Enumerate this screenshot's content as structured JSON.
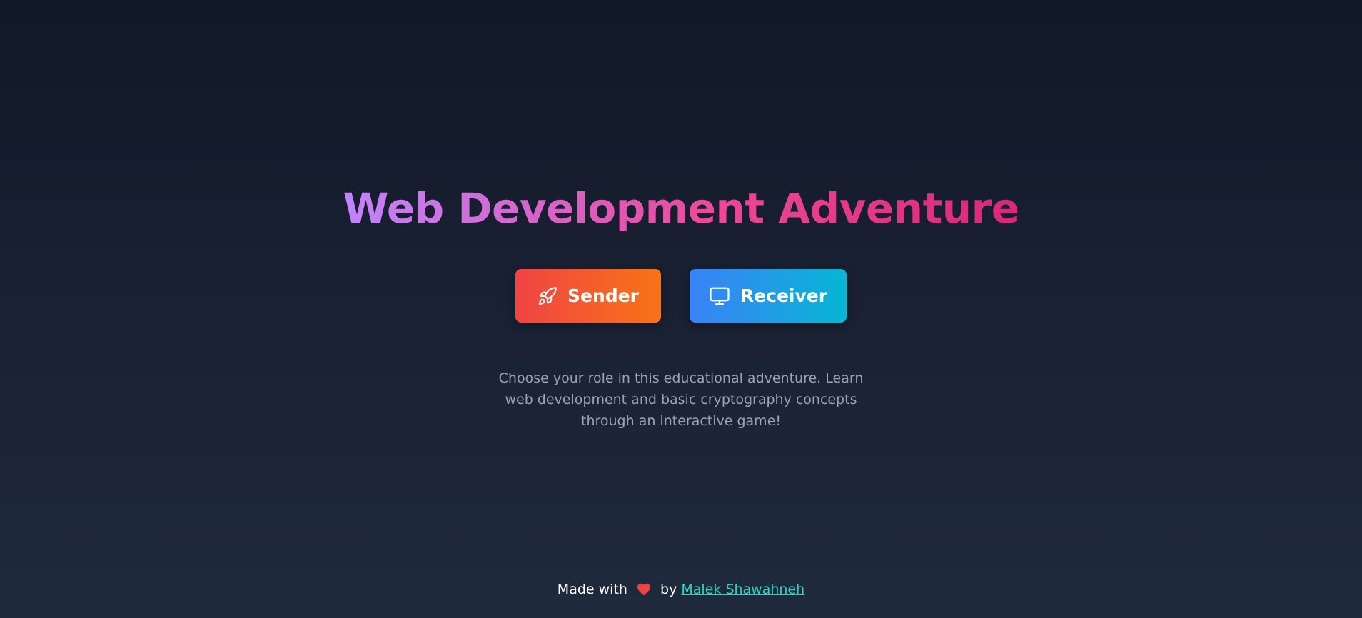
{
  "title": "Web Development Adventure",
  "buttons": {
    "sender": {
      "label": "Sender",
      "icon": "rocket-icon",
      "gradient": [
        "#ef4444",
        "#f97316"
      ]
    },
    "receiver": {
      "label": "Receiver",
      "icon": "monitor-icon",
      "gradient": [
        "#3b82f6",
        "#06b6d4"
      ]
    }
  },
  "description": "Choose your role in this educational adventure. Learn web development and basic cryptography concepts through an interactive game!",
  "footer": {
    "made_with": "Made with",
    "by": "by",
    "author": "Malek Shawahneh",
    "heart_icon": "heart-icon",
    "link_color": "#2dd4bf"
  },
  "colors": {
    "background_top": "#111827",
    "background_bottom": "#1f2a3d",
    "title_gradient": [
      "#c084fc",
      "#db2777"
    ]
  }
}
